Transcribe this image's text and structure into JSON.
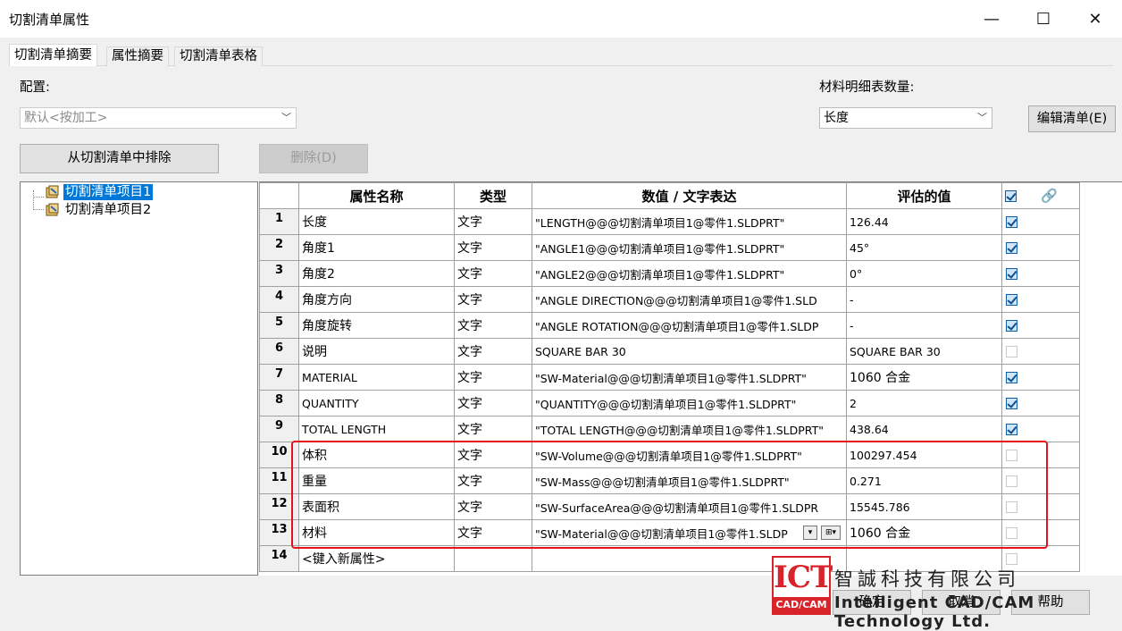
{
  "window": {
    "title": "切割清单属性",
    "min_glyph": "—",
    "max_glyph": "☐",
    "close_glyph": "✕"
  },
  "tabs": [
    {
      "label": "切割清单摘要",
      "active": true
    },
    {
      "label": "属性摘要",
      "active": false
    },
    {
      "label": "切割清单表格",
      "active": false
    }
  ],
  "config": {
    "label": "配置:",
    "value": "默认<按加工>"
  },
  "bom_qty": {
    "label": "材料明细表数量:",
    "value": "长度"
  },
  "buttons": {
    "edit_list": "编辑清单(E)",
    "exclude": "从切割清单中排除",
    "delete": "删除(D)"
  },
  "tree": {
    "items": [
      "切割清单项目1",
      "切割清单项目2"
    ]
  },
  "table": {
    "headers": [
      "属性名称",
      "类型",
      "数值 / 文字表达",
      "评估的值"
    ],
    "rows": [
      {
        "n": "1",
        "name": "长度",
        "type": "文字",
        "expr": "\"LENGTH@@@切割清单项目1@零件1.SLDPRT\"",
        "val": "126.44",
        "checked": true
      },
      {
        "n": "2",
        "name": "角度1",
        "type": "文字",
        "expr": "\"ANGLE1@@@切割清单项目1@零件1.SLDPRT\"",
        "val": "45°",
        "checked": true
      },
      {
        "n": "3",
        "name": "角度2",
        "type": "文字",
        "expr": "\"ANGLE2@@@切割清单项目1@零件1.SLDPRT\"",
        "val": "0°",
        "checked": true
      },
      {
        "n": "4",
        "name": "角度方向",
        "type": "文字",
        "expr": "\"ANGLE DIRECTION@@@切割清单项目1@零件1.SLD",
        "val": "-",
        "checked": true
      },
      {
        "n": "5",
        "name": "角度旋转",
        "type": "文字",
        "expr": "\"ANGLE ROTATION@@@切割清单项目1@零件1.SLDP",
        "val": "-",
        "checked": true
      },
      {
        "n": "6",
        "name": "说明",
        "type": "文字",
        "expr": "SQUARE BAR 30",
        "val": "SQUARE BAR 30",
        "checked": false
      },
      {
        "n": "7",
        "name": "MATERIAL",
        "type": "文字",
        "expr": "\"SW-Material@@@切割清单项目1@零件1.SLDPRT\"",
        "val": "1060 合金",
        "checked": true
      },
      {
        "n": "8",
        "name": "QUANTITY",
        "type": "文字",
        "expr": "\"QUANTITY@@@切割清单项目1@零件1.SLDPRT\"",
        "val": "2",
        "checked": true
      },
      {
        "n": "9",
        "name": "TOTAL LENGTH",
        "type": "文字",
        "expr": "\"TOTAL LENGTH@@@切割清单项目1@零件1.SLDPRT\"",
        "val": "438.64",
        "checked": true
      },
      {
        "n": "10",
        "name": "体积",
        "type": "文字",
        "expr": "\"SW-Volume@@@切割清单项目1@零件1.SLDPRT\"",
        "val": "100297.454",
        "checked": false
      },
      {
        "n": "11",
        "name": "重量",
        "type": "文字",
        "expr": "\"SW-Mass@@@切割清单项目1@零件1.SLDPRT\"",
        "val": "0.271",
        "checked": false
      },
      {
        "n": "12",
        "name": "表面积",
        "type": "文字",
        "expr": "\"SW-SurfaceArea@@@切割清单项目1@零件1.SLDPR",
        "val": "15545.786",
        "checked": false
      },
      {
        "n": "13",
        "name": "材料",
        "type": "文字",
        "expr": "\"SW-Material@@@切割清单项目1@零件1.SLDP",
        "val": "1060 合金",
        "checked": false
      },
      {
        "n": "14",
        "name": "<键入新属性>",
        "type": "",
        "expr": "",
        "val": "",
        "checked": false
      }
    ]
  },
  "bottom_buttons": [
    "确定",
    "取消",
    "帮助"
  ],
  "logo": {
    "mark": "ICT",
    "mark_sub": "CAD/CAM",
    "cn": "智誠科技有限公司",
    "en": "Intelligent CAD/CAM Technology Ltd.",
    "red": "#d8232a"
  },
  "colors": {
    "selection": "#0078d7",
    "highlight_border": "#e8101a"
  }
}
